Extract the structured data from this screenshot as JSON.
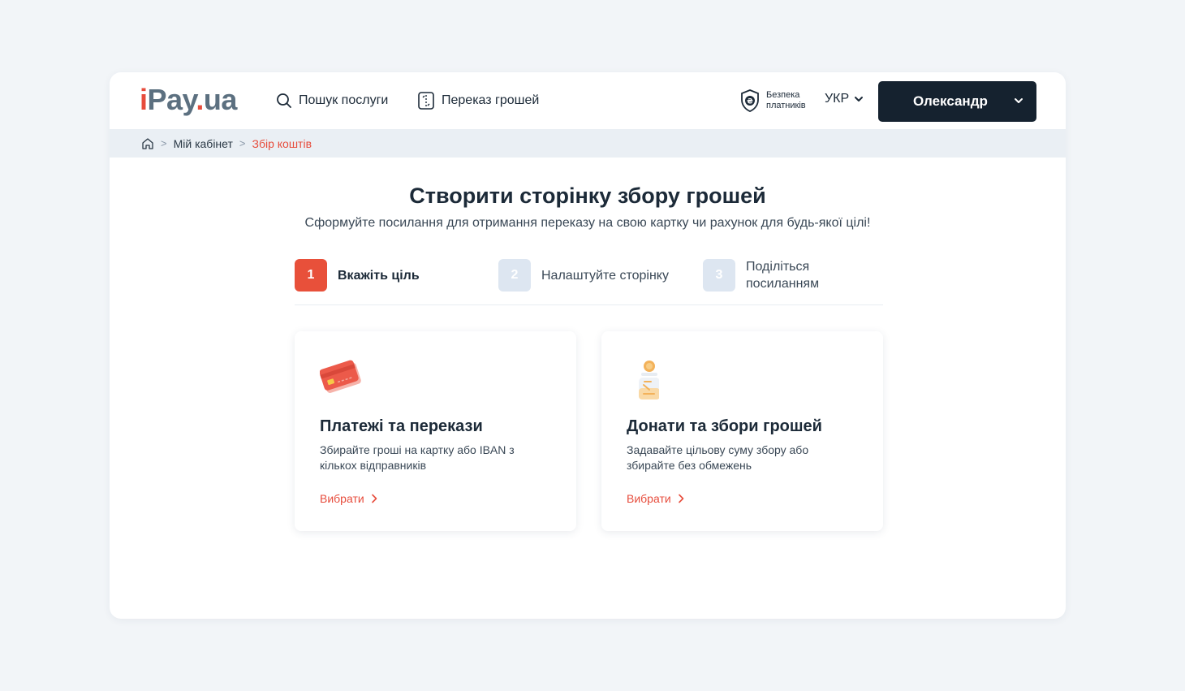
{
  "header": {
    "logo": {
      "i": "i",
      "pay": "Pay",
      "dot": ".",
      "ua": "ua"
    },
    "nav": [
      {
        "label": "Пошук послуги",
        "icon": "search-icon"
      },
      {
        "label": "Переказ грошей",
        "icon": "transfer-icon"
      }
    ],
    "safety": {
      "line1": "Безпека",
      "line2": "платників",
      "icon": "shield-hryvnia-icon"
    },
    "language": "УКР",
    "user": "Олександр"
  },
  "breadcrumb": {
    "items": [
      "Мій кабінет",
      "Збір коштів"
    ],
    "home_icon": "home-icon"
  },
  "main": {
    "title": "Створити сторінку збору грошей",
    "subtitle": "Сформуйте посилання для отримання переказу на свою картку чи рахунок для будь-якої цілі!",
    "steps": [
      {
        "num": "1",
        "label": "Вкажіть ціль",
        "active": true
      },
      {
        "num": "2",
        "label": "Налаштуйте сторінку",
        "active": false
      },
      {
        "num": "3",
        "label": "Поділіться посиланням",
        "active": false
      }
    ],
    "cards": [
      {
        "title": "Платежі та перекази",
        "desc": "Збирайте гроші на картку або IBAN з кількох відправників",
        "link": "Вибрати",
        "icon": "credit-card-icon"
      },
      {
        "title": "Донати та збори грошей",
        "desc": "Задавайте цільову суму збору або збирайте без обмежень",
        "link": "Вибрати",
        "icon": "donation-jar-icon"
      }
    ]
  },
  "colors": {
    "accent": "#e74c3c",
    "dark": "#15222f",
    "background": "#f2f5f8",
    "breadcrumb_bg": "#eaeff4"
  }
}
